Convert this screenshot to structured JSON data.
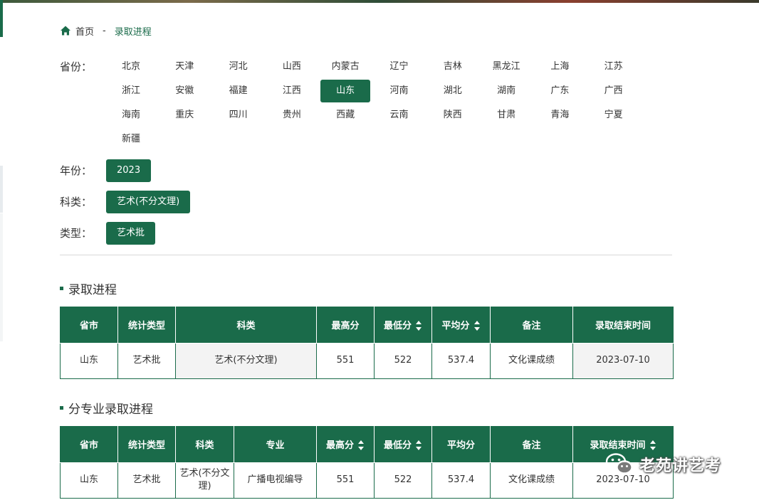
{
  "breadcrumb": {
    "home": "首页",
    "separator": "-",
    "current": "录取进程"
  },
  "filters": {
    "province_label": "省份：",
    "year_label": "年份：",
    "subject_label": "科类：",
    "type_label": "类型：",
    "provinces": [
      "北京",
      "天津",
      "河北",
      "山西",
      "内蒙古",
      "辽宁",
      "吉林",
      "黑龙江",
      "上海",
      "江苏",
      "浙江",
      "安徽",
      "福建",
      "江西",
      "山东",
      "河南",
      "湖北",
      "湖南",
      "广东",
      "广西",
      "海南",
      "重庆",
      "四川",
      "贵州",
      "西藏",
      "云南",
      "陕西",
      "甘肃",
      "青海",
      "宁夏",
      "新疆"
    ],
    "active_province": "山东",
    "year": "2023",
    "subject": "艺术(不分文理)",
    "type": "艺术批"
  },
  "section1": {
    "title": "录取进程",
    "headers": [
      "省市",
      "统计类型",
      "科类",
      "最高分",
      "最低分",
      "平均分",
      "备注",
      "录取结束时间"
    ],
    "rows": [
      [
        "山东",
        "艺术批",
        "艺术(不分文理)",
        "551",
        "522",
        "537.4",
        "文化课成绩",
        "2023-07-10"
      ]
    ]
  },
  "section2": {
    "title": "分专业录取进程",
    "headers": [
      "省市",
      "统计类型",
      "科类",
      "专业",
      "最高分",
      "最低分",
      "平均分",
      "备注",
      "录取结束时间"
    ],
    "rows": [
      [
        "山东",
        "艺术批",
        "艺术(不分文\n理)",
        "广播电视编导",
        "551",
        "522",
        "537.4",
        "文化课成绩",
        "2023-07-10"
      ]
    ]
  },
  "watermark": {
    "text": "老苑讲艺考",
    "icon": "wechat-icon"
  },
  "colors": {
    "accent": "#1a6b4a"
  }
}
